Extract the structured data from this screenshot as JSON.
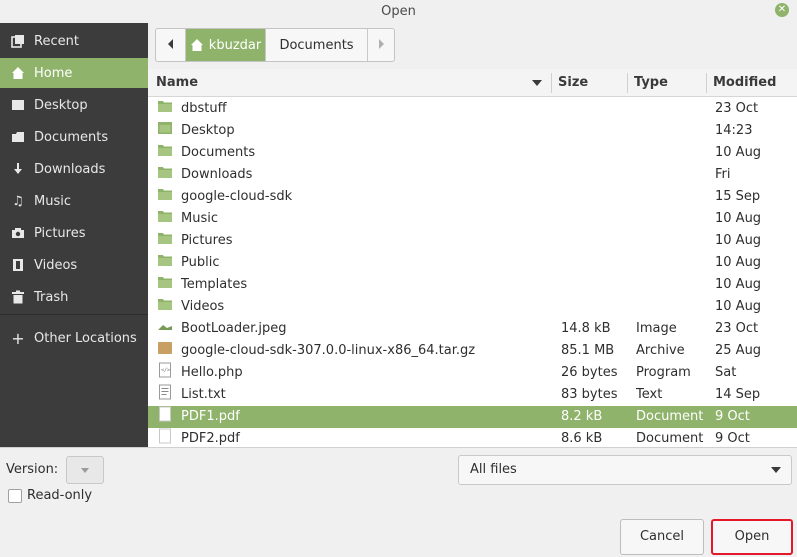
{
  "window": {
    "title": "Open"
  },
  "sidebar": {
    "items": [
      {
        "label": "Recent",
        "icon": "recent-icon"
      },
      {
        "label": "Home",
        "icon": "home-icon",
        "active": true
      },
      {
        "label": "Desktop",
        "icon": "desktop-icon"
      },
      {
        "label": "Documents",
        "icon": "documents-icon"
      },
      {
        "label": "Downloads",
        "icon": "download-icon"
      },
      {
        "label": "Music",
        "icon": "music-icon"
      },
      {
        "label": "Pictures",
        "icon": "camera-icon"
      },
      {
        "label": "Videos",
        "icon": "film-icon"
      },
      {
        "label": "Trash",
        "icon": "trash-icon"
      },
      {
        "label": "Other Locations",
        "icon": "plus-icon"
      }
    ]
  },
  "pathbar": {
    "home": "kbuzdar",
    "current": "Documents"
  },
  "columns": {
    "name": "Name",
    "size": "Size",
    "type": "Type",
    "modified": "Modified"
  },
  "files": [
    {
      "name": "dbstuff",
      "size": "",
      "type": "",
      "modified": "23 Oct",
      "icon": "folder-icon"
    },
    {
      "name": "Desktop",
      "size": "",
      "type": "",
      "modified": "14:23",
      "icon": "desktop-folder-icon"
    },
    {
      "name": "Documents",
      "size": "",
      "type": "",
      "modified": "10 Aug",
      "icon": "folder-icon"
    },
    {
      "name": "Downloads",
      "size": "",
      "type": "",
      "modified": "Fri",
      "icon": "folder-icon"
    },
    {
      "name": "google-cloud-sdk",
      "size": "",
      "type": "",
      "modified": "15 Sep",
      "icon": "folder-icon"
    },
    {
      "name": "Music",
      "size": "",
      "type": "",
      "modified": "10 Aug",
      "icon": "folder-icon"
    },
    {
      "name": "Pictures",
      "size": "",
      "type": "",
      "modified": "10 Aug",
      "icon": "folder-icon"
    },
    {
      "name": "Public",
      "size": "",
      "type": "",
      "modified": "10 Aug",
      "icon": "folder-icon"
    },
    {
      "name": "Templates",
      "size": "",
      "type": "",
      "modified": "10 Aug",
      "icon": "folder-icon"
    },
    {
      "name": "Videos",
      "size": "",
      "type": "",
      "modified": "10 Aug",
      "icon": "folder-icon"
    },
    {
      "name": "BootLoader.jpeg",
      "size": "14.8 kB",
      "type": "Image",
      "modified": "23 Oct",
      "icon": "image-file-icon"
    },
    {
      "name": "google-cloud-sdk-307.0.0-linux-x86_64.tar.gz",
      "size": "85.1 MB",
      "type": "Archive",
      "modified": "25 Aug",
      "icon": "archive-file-icon"
    },
    {
      "name": "Hello.php",
      "size": "26 bytes",
      "type": "Program",
      "modified": "Sat",
      "icon": "code-file-icon"
    },
    {
      "name": "List.txt",
      "size": "83 bytes",
      "type": "Text",
      "modified": "14 Sep",
      "icon": "text-file-icon"
    },
    {
      "name": "PDF1.pdf",
      "size": "8.2 kB",
      "type": "Document",
      "modified": "9 Oct",
      "icon": "document-file-icon",
      "selected": true
    },
    {
      "name": "PDF2.pdf",
      "size": "8.6 kB",
      "type": "Document",
      "modified": "9 Oct",
      "icon": "document-file-icon"
    }
  ],
  "footer": {
    "version_label": "Version:",
    "readonly_label": "Read-only",
    "filter_value": "All files",
    "cancel_label": "Cancel",
    "open_label": "Open"
  },
  "colors": {
    "accent": "#8fb36b",
    "sidebar_bg": "#3c3c3c",
    "highlight_border": "#e3182a"
  }
}
